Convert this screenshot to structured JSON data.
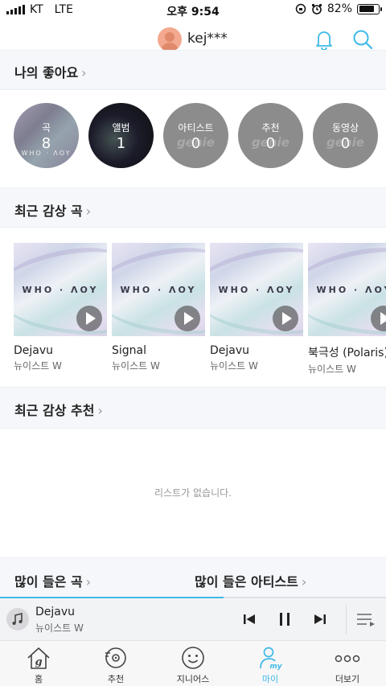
{
  "status_bar": {
    "carrier": "KT",
    "network": "LTE",
    "time": "오후 9:54",
    "battery": "82%"
  },
  "header": {
    "username": "kej***"
  },
  "likes_section": {
    "title": "나의 좋아요",
    "items": [
      {
        "label": "곡",
        "count": "8"
      },
      {
        "label": "앨범",
        "count": "1"
      },
      {
        "label": "아티스트",
        "count": "0"
      },
      {
        "label": "추천",
        "count": "0"
      },
      {
        "label": "동영상",
        "count": "0"
      }
    ],
    "watermark": "genie"
  },
  "recent_songs": {
    "title": "최근 감상 곡",
    "cover_text": "WHO · ɅOY",
    "items": [
      {
        "title": "Dejavu",
        "artist": "뉴이스트 W"
      },
      {
        "title": "Signal",
        "artist": "뉴이스트 W"
      },
      {
        "title": "Dejavu",
        "artist": "뉴이스트 W"
      },
      {
        "title": "북극성 (Polaris)",
        "artist": "뉴이스트 W"
      }
    ]
  },
  "recent_recommend": {
    "title": "최근 감상 추천",
    "empty_text": "리스트가 없습니다."
  },
  "bottom_links": {
    "most_played_songs": "많이 들은 곡",
    "most_played_artists": "많이 들은 아티스트"
  },
  "player": {
    "title": "Dejavu",
    "artist": "뉴이스트 W",
    "progress": 0.58
  },
  "tabs": [
    {
      "label": "홈",
      "icon": "home-icon"
    },
    {
      "label": "추천",
      "icon": "recommend-icon"
    },
    {
      "label": "지니어스",
      "icon": "genius-icon"
    },
    {
      "label": "마이",
      "icon": "my-icon",
      "active": true
    },
    {
      "label": "더보기",
      "icon": "more-icon"
    }
  ],
  "colors": {
    "accent": "#3fb9e6"
  }
}
